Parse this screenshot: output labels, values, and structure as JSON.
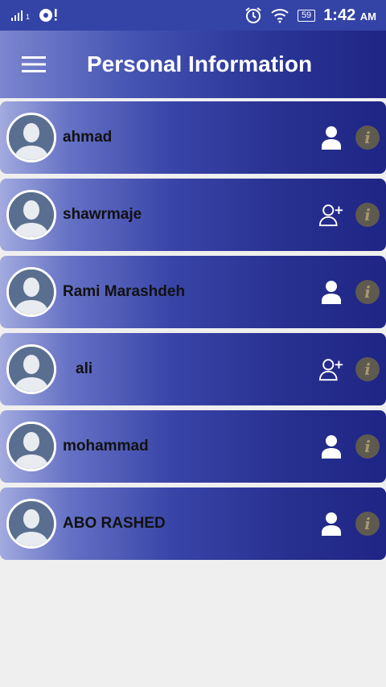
{
  "status_bar": {
    "battery": "59",
    "time": "1:42",
    "ampm": "AM",
    "signal_suffix": "1"
  },
  "app_bar": {
    "title": "Personal Information",
    "menu_icon": "hamburger-menu-icon"
  },
  "contacts": [
    {
      "name": "ahmad",
      "status_icon": "person-icon"
    },
    {
      "name": "shawrmaje",
      "status_icon": "add-person-icon"
    },
    {
      "name": "Rami Marashdeh",
      "status_icon": "person-icon"
    },
    {
      "name": "ali",
      "status_icon": "add-person-icon"
    },
    {
      "name": "mohammad",
      "status_icon": "person-icon"
    },
    {
      "name": "ABO RASHED",
      "status_icon": "person-icon"
    }
  ],
  "info_glyph": "i",
  "colors": {
    "status_bar": "#3343a6",
    "accent_dark": "#1f2585",
    "background": "#efefef"
  }
}
